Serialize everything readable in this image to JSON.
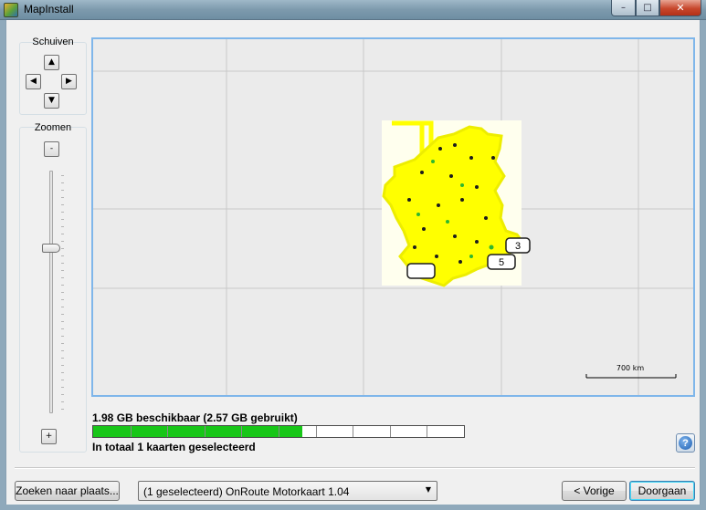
{
  "window": {
    "title": "MapInstall",
    "app_icon": "mapinstall-app-icon",
    "controls": {
      "minimize_icon": "minimize-icon",
      "maximize_icon": "maximize-icon",
      "close_icon": "close-icon"
    }
  },
  "pan": {
    "title": "Schuiven",
    "up_icon": "arrow-up-icon",
    "left_icon": "arrow-left-icon",
    "right_icon": "arrow-right-icon",
    "down_icon": "arrow-down-icon"
  },
  "zoom": {
    "title": "Zoomen",
    "minus_label": "-",
    "plus_label": "+",
    "slider_level_fraction": 0.32
  },
  "map": {
    "scale_label": "700 km",
    "tile_labels": [
      "3",
      "5"
    ],
    "colors": {
      "selected_region": "#ffff00",
      "tile_background": "#ffffee",
      "selection_border": "#7fb6ea"
    }
  },
  "storage": {
    "available_text": "1.98 GB beschikbaar (2.57 GB gebruikt)",
    "used_fraction": 0.565,
    "selected_text": "In totaal 1 kaarten geselecteerd",
    "fill_color": "#18c618"
  },
  "help": {
    "icon": "help-icon",
    "label": "?"
  },
  "footer": {
    "search_button": "Zoeken naar plaats...",
    "map_select_value": "(1 geselecteerd) OnRoute Motorkaart 1.04",
    "prev_button": "< Vorige",
    "finish_button": "Doorgaan"
  }
}
